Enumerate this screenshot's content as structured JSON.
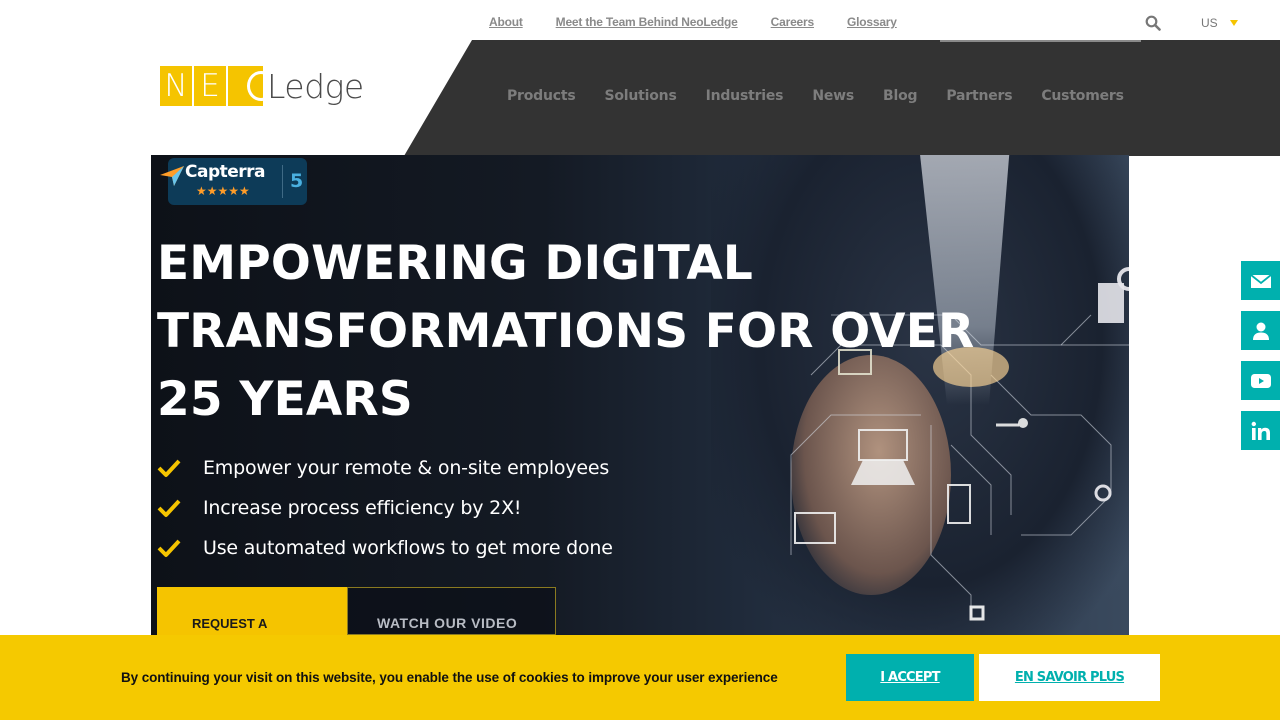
{
  "top_links": [
    "About",
    "Meet the Team Behind NeoLedge",
    "Careers",
    "Glossary"
  ],
  "language": {
    "selected": "US"
  },
  "logo": {
    "letters": [
      "N",
      "E",
      "O"
    ],
    "text": "Ledge"
  },
  "main_nav": [
    "Products",
    "Solutions",
    "Industries",
    "News",
    "Blog",
    "Partners",
    "Customers"
  ],
  "hero": {
    "badge": {
      "name": "Capterra",
      "stars": "★★★★★",
      "score": "5"
    },
    "headline_lines": [
      "EMPOWERING DIGITAL",
      "TRANSFORMATIONS FOR OVER",
      "25 YEARS"
    ],
    "bullets": [
      "Empower your remote & on-site employees",
      "Increase process efficiency by 2X!",
      "Use automated workflows to get more done"
    ],
    "cta_primary": "REQUEST A",
    "cta_secondary": "WATCH OUR VIDEO"
  },
  "social": [
    "email",
    "contact",
    "youtube",
    "linkedin"
  ],
  "cookie": {
    "text": "By continuing your visit on this website, you enable the use of cookies to improve your user experience",
    "accept": "I ACCEPT",
    "more": "EN SAVOIR PLUS"
  },
  "colors": {
    "brand_yellow": "#f5c400",
    "teal": "#00b0ae",
    "nav_dark": "#333333"
  }
}
